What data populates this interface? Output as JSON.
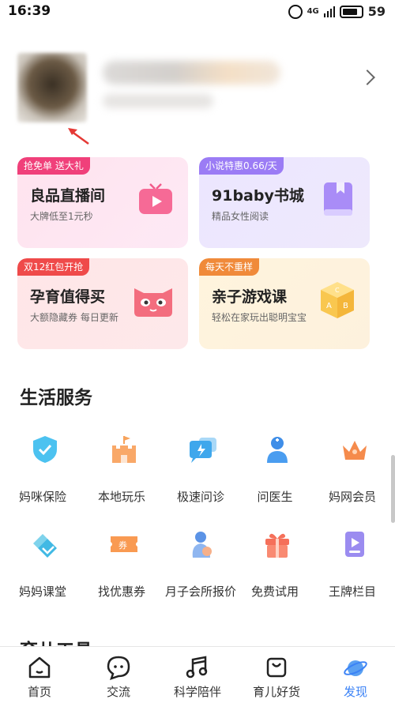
{
  "status": {
    "time": "16:39",
    "network": "4G",
    "battery": "59"
  },
  "cards": [
    {
      "tag": "抢免单 送大礼",
      "title": "良品直播间",
      "subtitle": "大牌低至1元秒"
    },
    {
      "tag": "小说特惠0.66/天",
      "title": "91baby书城",
      "subtitle": "精品女性阅读"
    },
    {
      "tag": "双12红包开抢",
      "title": "孕育值得买",
      "subtitle": "大额隐藏券 每日更新"
    },
    {
      "tag": "每天不重样",
      "title": "亲子游戏课",
      "subtitle": "轻松在家玩出聪明宝宝"
    }
  ],
  "services": {
    "title": "生活服务",
    "items": [
      {
        "label": "妈咪保险",
        "icon": "shield-check-icon"
      },
      {
        "label": "本地玩乐",
        "icon": "castle-icon"
      },
      {
        "label": "极速问诊",
        "icon": "chat-bubbles-icon"
      },
      {
        "label": "问医生",
        "icon": "doctor-icon"
      },
      {
        "label": "妈网会员",
        "icon": "crown-icon"
      },
      {
        "label": "妈妈课堂",
        "icon": "classroom-icon"
      },
      {
        "label": "找优惠券",
        "icon": "coupon-icon"
      },
      {
        "label": "月子会所报价",
        "icon": "mother-baby-icon"
      },
      {
        "label": "免费试用",
        "icon": "gift-box-icon"
      },
      {
        "label": "王牌栏目",
        "icon": "video-play-icon"
      }
    ]
  },
  "next_section": {
    "title": "育儿工具"
  },
  "tabs": [
    {
      "label": "首页",
      "icon": "home-icon"
    },
    {
      "label": "交流",
      "icon": "chat-icon"
    },
    {
      "label": "科学陪伴",
      "icon": "music-note-icon"
    },
    {
      "label": "育儿好货",
      "icon": "shopping-bag-icon"
    },
    {
      "label": "发现",
      "icon": "discover-planet-icon"
    }
  ],
  "colors": {
    "active_tab": "#3b82f6",
    "tag_pink": "#f0407a",
    "tag_purple": "#9b7cf5",
    "tag_red": "#ef4a4a",
    "tag_orange": "#f08a3a"
  }
}
